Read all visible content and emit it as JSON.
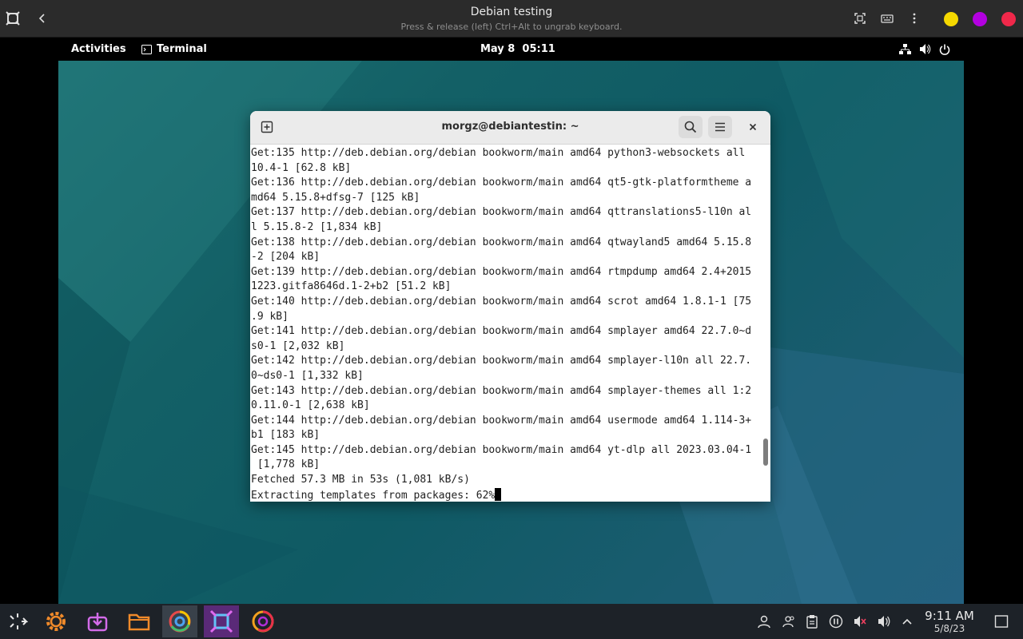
{
  "host": {
    "title": "Debian testing",
    "subtitle": "Press & release (left) Ctrl+Alt to ungrab keyboard.",
    "icons": [
      "boxes-logo-icon",
      "back-icon",
      "fullscreen-icon",
      "keyboard-icon",
      "kebab-menu-icon"
    ],
    "window_dots": {
      "minimize": "#f5d800",
      "maximize": "#b300e0",
      "close": "#f0284a"
    }
  },
  "gnome": {
    "activities": "Activities",
    "app_name": "Terminal",
    "date": "May 8",
    "time": "05:11"
  },
  "terminal": {
    "title": "morgz@debiantestin: ~",
    "lines": [
      "Get:135 http://deb.debian.org/debian bookworm/main amd64 python3-websockets all",
      "10.4-1 [62.8 kB]",
      "Get:136 http://deb.debian.org/debian bookworm/main amd64 qt5-gtk-platformtheme a",
      "md64 5.15.8+dfsg-7 [125 kB]",
      "Get:137 http://deb.debian.org/debian bookworm/main amd64 qttranslations5-l10n al",
      "l 5.15.8-2 [1,834 kB]",
      "Get:138 http://deb.debian.org/debian bookworm/main amd64 qtwayland5 amd64 5.15.8",
      "-2 [204 kB]",
      "Get:139 http://deb.debian.org/debian bookworm/main amd64 rtmpdump amd64 2.4+2015",
      "1223.gitfa8646d.1-2+b2 [51.2 kB]",
      "Get:140 http://deb.debian.org/debian bookworm/main amd64 scrot amd64 1.8.1-1 [75",
      ".9 kB]",
      "Get:141 http://deb.debian.org/debian bookworm/main amd64 smplayer amd64 22.7.0~d",
      "s0-1 [2,032 kB]",
      "Get:142 http://deb.debian.org/debian bookworm/main amd64 smplayer-l10n all 22.7.",
      "0~ds0-1 [1,332 kB]",
      "Get:143 http://deb.debian.org/debian bookworm/main amd64 smplayer-themes all 1:2",
      "0.11.0-1 [2,638 kB]",
      "Get:144 http://deb.debian.org/debian bookworm/main amd64 usermode amd64 1.114-3+",
      "b1 [183 kB]",
      "Get:145 http://deb.debian.org/debian bookworm/main amd64 yt-dlp all 2023.03.04-1",
      " [1,778 kB]",
      "Fetched 57.3 MB in 53s (1,081 kB/s)",
      "Extracting templates from packages: 62%"
    ]
  },
  "taskbar": {
    "apps": [
      "launcher-icon",
      "settings-icon",
      "discover-icon",
      "files-icon",
      "chrome-icon",
      "boxes-icon",
      "firefox-icon"
    ],
    "tray": [
      "user-icon",
      "users-icon",
      "clipboard-icon",
      "pause-icon",
      "mute-icon",
      "volume-icon",
      "chevron-up-icon"
    ],
    "time": "9:11 AM",
    "date": "5/8/23"
  }
}
